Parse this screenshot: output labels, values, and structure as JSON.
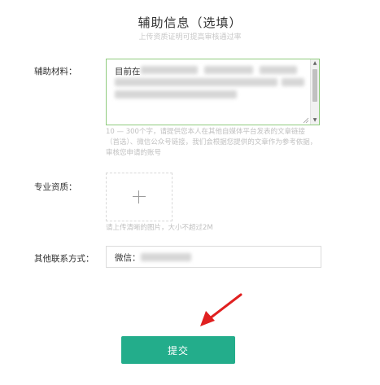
{
  "header": {
    "title": "辅助信息（选填）",
    "subtitle": "上传资质证明可提高审核通过率"
  },
  "form": {
    "materials": {
      "label": "辅助材料：",
      "value_visible": "目前在",
      "hint_line1": "10 — 300个字，请提供您本人在其他自媒体平台发表的文章链接",
      "hint_line2": "（首选）、微信公众号链接，我们会根据您提供的文章作为参考依据，",
      "hint_line3": "审核您申请的账号"
    },
    "qualification": {
      "label": "专业资质：",
      "hint": "请上传清晰的图片，大小不超过2M"
    },
    "contact": {
      "label": "其他联系方式：",
      "prefix": "微信："
    }
  },
  "submit": {
    "label": "提交"
  },
  "colors": {
    "accent": "#23ad8b",
    "focus_border": "#8fcc7d",
    "arrow": "#e02020"
  },
  "icons": [
    "plus-icon",
    "red-arrow-icon"
  ]
}
